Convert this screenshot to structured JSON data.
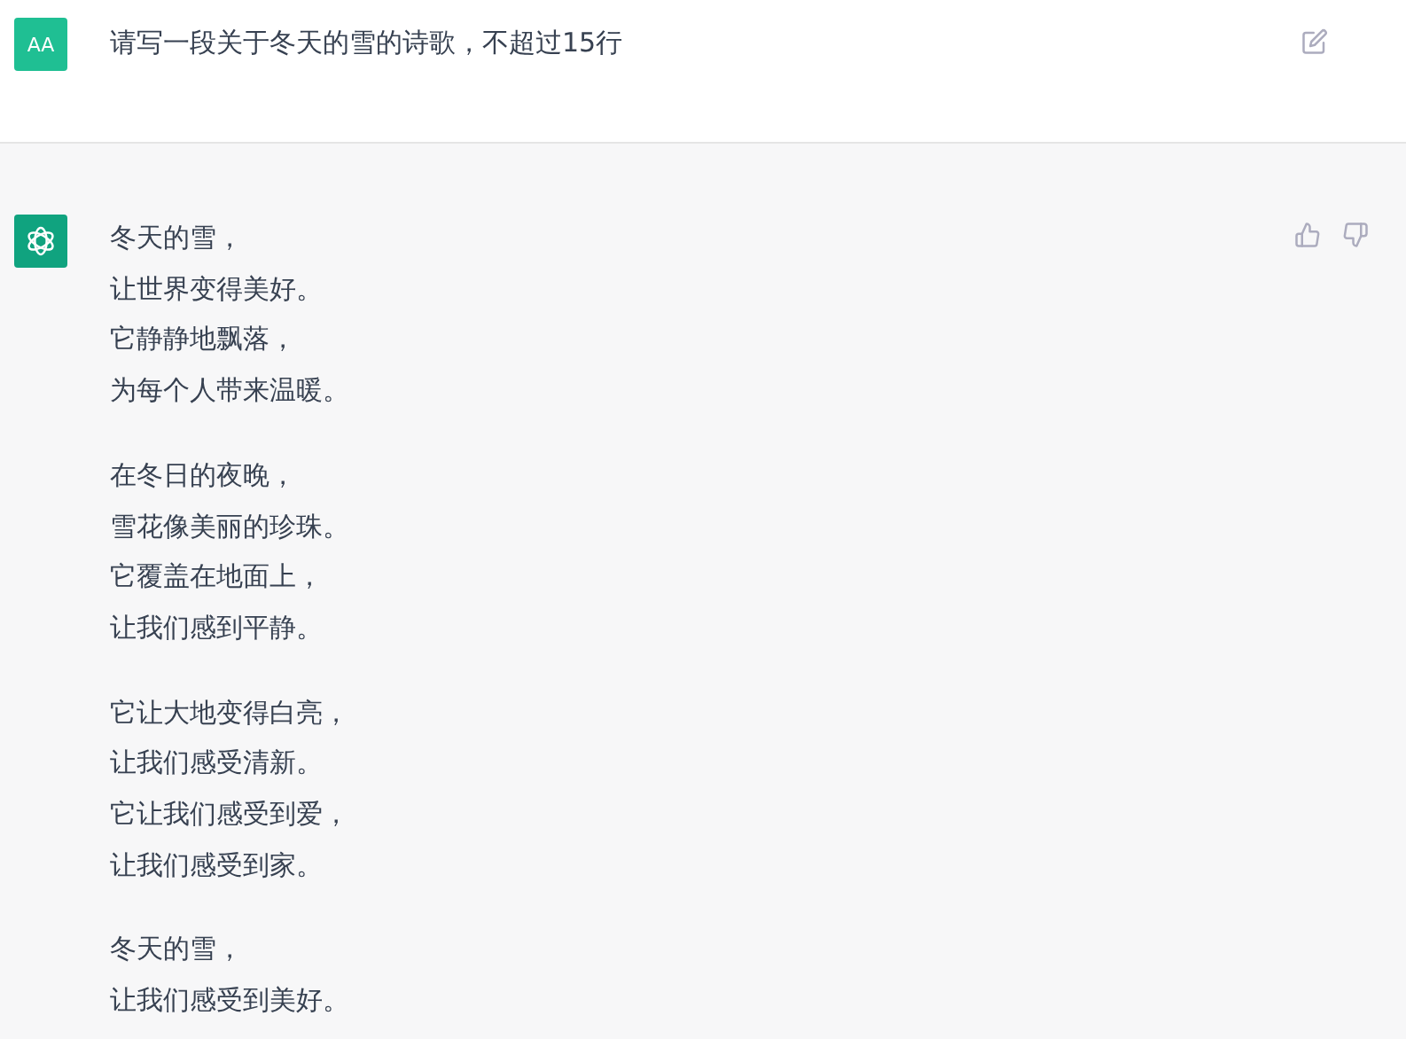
{
  "user_message": {
    "avatar": "AA",
    "text": "请写一段关于冬天的雪的诗歌，不超过15行"
  },
  "assistant_message": {
    "stanzas": [
      [
        "冬天的雪，",
        "让世界变得美好。",
        "它静静地飘落，",
        "为每个人带来温暖。"
      ],
      [
        "在冬日的夜晚，",
        "雪花像美丽的珍珠。",
        "它覆盖在地面上，",
        "让我们感到平静。"
      ],
      [
        "它让大地变得白亮，",
        "让我们感受清新。",
        "它让我们感受到爱，",
        "让我们感受到家。"
      ],
      [
        "冬天的雪，",
        "让我们感受到美好。"
      ]
    ]
  }
}
